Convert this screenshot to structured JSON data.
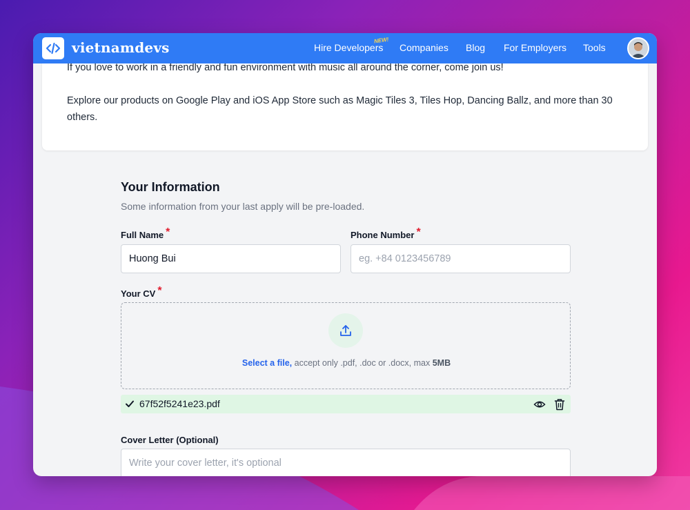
{
  "brand": {
    "name": "vietnamdevs",
    "logo_icon": "code-brackets-icon"
  },
  "nav": {
    "items": [
      {
        "label": "Hire Developers",
        "badge": "NEW!"
      },
      {
        "label": "Companies"
      },
      {
        "label": "Blog"
      },
      {
        "label": "For Employers"
      },
      {
        "label": "Tools"
      }
    ],
    "avatar": "user-avatar"
  },
  "company_card": {
    "paragraph1": "If you love to work in a friendly and fun environment with music all around the corner, come join us!",
    "paragraph2": "Explore our products on Google Play and iOS App Store such as Magic Tiles 3, Tiles Hop, Dancing Ballz, and more than 30 others."
  },
  "form": {
    "title": "Your Information",
    "subtitle": "Some information from your last apply will be pre-loaded.",
    "required_mark": "*",
    "full_name": {
      "label": "Full Name",
      "value": "Huong Bui"
    },
    "phone": {
      "label": "Phone Number",
      "placeholder": "eg. +84 0123456789"
    },
    "cv": {
      "label": "Your CV",
      "select_link": "Select a file,",
      "accept_text": " accept only .pdf, .doc or .docx, max ",
      "max_size": "5MB",
      "uploaded_file": "67f52f5241e23.pdf"
    },
    "cover_letter": {
      "label": "Cover Letter (Optional)",
      "placeholder": "Write your cover letter, it's optional"
    }
  },
  "colors": {
    "nav_bg": "#2f7bf5",
    "link": "#2563eb",
    "required": "#e11d2e",
    "file_row_bg": "#dff6e4"
  }
}
